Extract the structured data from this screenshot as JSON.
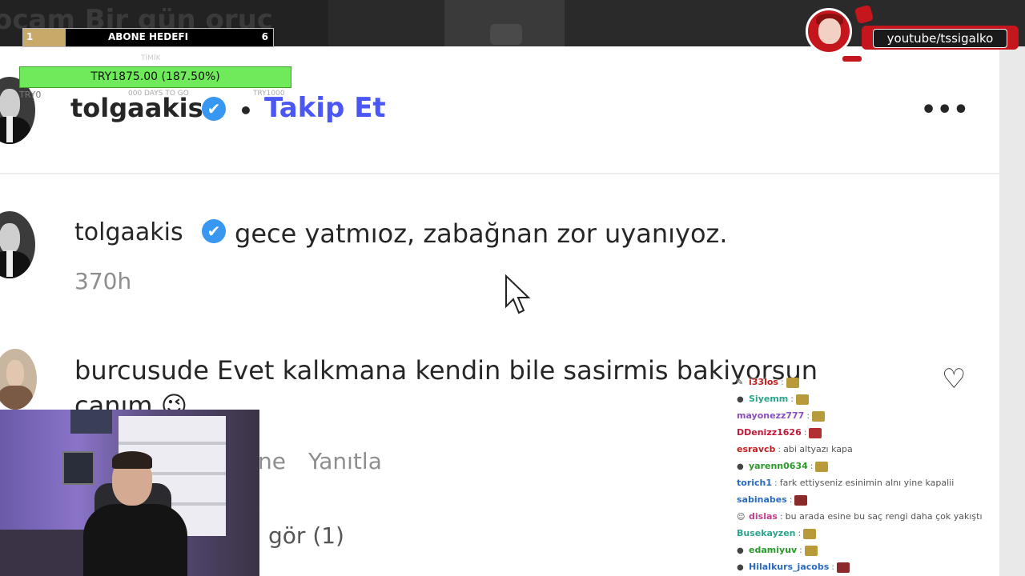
{
  "background": {
    "title_fragment": "ocam Bir gün oruç"
  },
  "overlays": {
    "sub_goal": {
      "left": "1",
      "title": "ABONE HEDEFI",
      "right": "6",
      "progress": 0.17
    },
    "donation": {
      "text": "TRY1875.00 (187.50%)",
      "progress": 1.0,
      "small_top": "TİMİK",
      "small_left": "TRY0",
      "small_mid": "000 DAYS TO GO",
      "small_right": "TRY1000"
    },
    "channel_url": "youtube/tssigalko"
  },
  "post": {
    "username": "tolgaakis",
    "verified": "✔",
    "separator": "•",
    "follow_label": "Takip Et",
    "more_label": "•••"
  },
  "comments": [
    {
      "username": "tolgaakis",
      "text": "gece yatmıoz, zabağnan zor uyanıyoz.",
      "time": "370h"
    },
    {
      "username": "burcusude",
      "text": "Evet kalkmana kendin bile sasirmis bakiyorsun",
      "text2": "canım 😉",
      "partial_like": "ne",
      "reply": "Yanıtla",
      "view_replies": "gör (1)"
    }
  ],
  "chat": [
    {
      "user": "i33los",
      "color": "#c02020",
      "icon": "✎",
      "msg": "",
      "emote": "#b89a3a"
    },
    {
      "user": "Siyemm",
      "color": "#2aa58a",
      "icon": "●",
      "msg": "",
      "emote": "#b89a3a"
    },
    {
      "user": "mayonezz777",
      "color": "#8a4fc0",
      "icon": "",
      "msg": "",
      "emote": "#b89a3a"
    },
    {
      "user": "DDenizz1626",
      "color": "#c01a3a",
      "icon": "",
      "msg": "",
      "emote": "#b23030"
    },
    {
      "user": "esravcb",
      "color": "#c02020",
      "icon": "",
      "msg": "abi altyazı kapa",
      "emote": ""
    },
    {
      "user": "yarenn0634",
      "color": "#2a9a2a",
      "icon": "●",
      "msg": "",
      "emote": "#b89a3a"
    },
    {
      "user": "torich1",
      "color": "#2a6ac0",
      "icon": "",
      "msg": "fark ettiyseniz esinimin alnı yine kapalii",
      "emote": ""
    },
    {
      "user": "sabinabes",
      "color": "#2a6ac0",
      "icon": "",
      "msg": "",
      "emote": "#8a2a2a"
    },
    {
      "user": "dislas",
      "color": "#c04090",
      "icon": "☺",
      "msg": "bu arada esine bu saç rengi daha çok yakıştı",
      "emote": ""
    },
    {
      "user": "Busekayzen",
      "color": "#2aa58a",
      "icon": "",
      "msg": "",
      "emote": "#b89a3a"
    },
    {
      "user": "edamiyuv",
      "color": "#2a9a2a",
      "icon": "●",
      "msg": "",
      "emote": "#b89a3a"
    },
    {
      "user": "Hilalkurs_jacobs",
      "color": "#2a6ac0",
      "icon": "●",
      "msg": "",
      "emote": "#8a2a2a"
    }
  ]
}
